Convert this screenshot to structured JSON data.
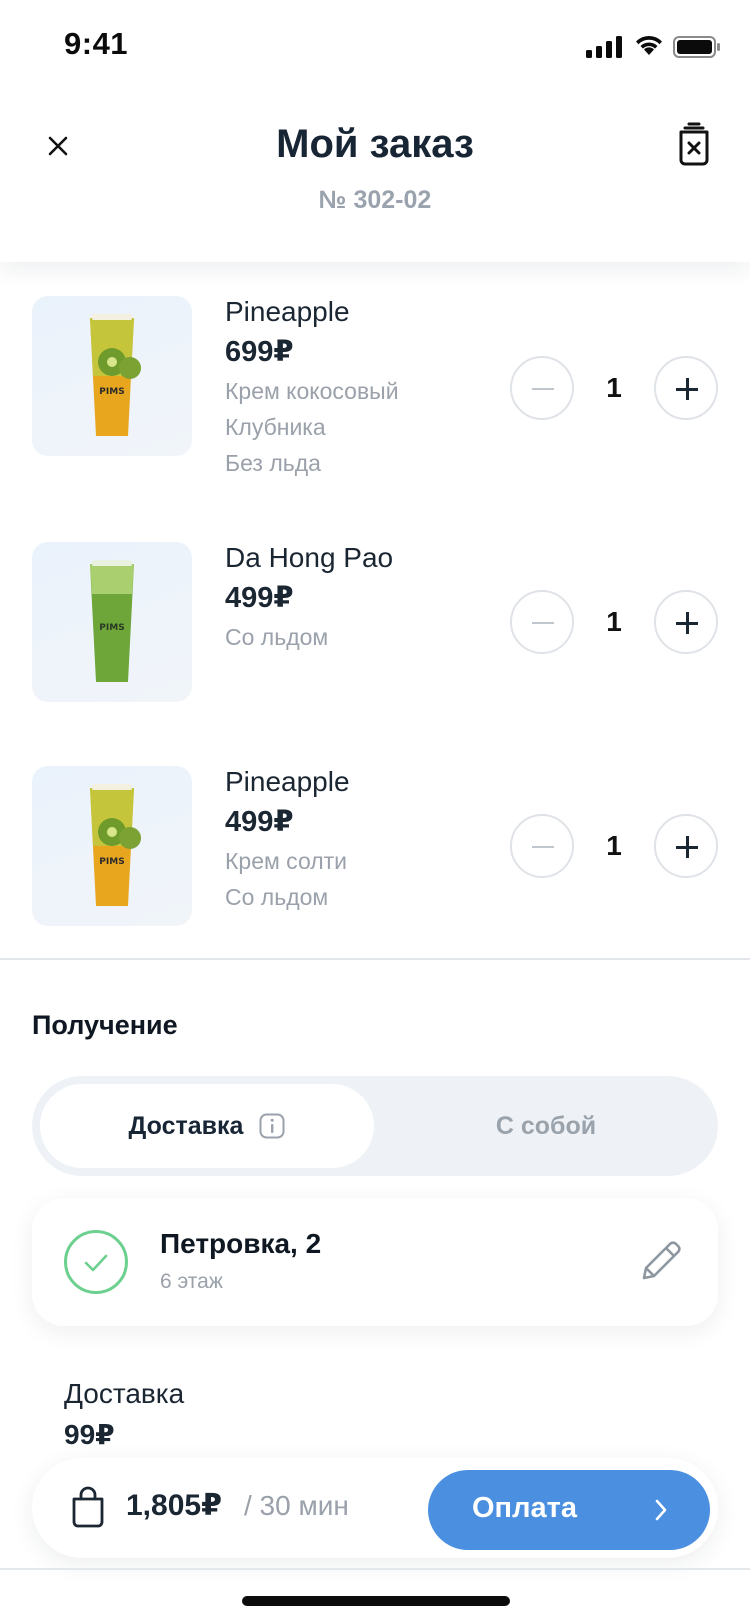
{
  "status_bar": {
    "time": "9:41"
  },
  "header": {
    "title": "Мой заказ",
    "order_number": "№ 302-02"
  },
  "items": [
    {
      "name": "Pineapple",
      "price": "699₽",
      "options": [
        "Крем кокосовый",
        "Клубника",
        "Без льда"
      ],
      "quantity": "1",
      "image": "pineapple-drink"
    },
    {
      "name": "Da Hong Pao",
      "price": "499₽",
      "options": [
        "Со льдом"
      ],
      "quantity": "1",
      "image": "green-tea-drink"
    },
    {
      "name": "Pineapple",
      "price": "499₽",
      "options": [
        "Крем солти",
        "Со льдом"
      ],
      "quantity": "1",
      "image": "pineapple-drink"
    }
  ],
  "receiving": {
    "title": "Получение",
    "tabs": [
      {
        "label": "Доставка",
        "active": true
      },
      {
        "label": "С собой",
        "active": false
      }
    ],
    "address": {
      "main": "Петровка, 2",
      "sub": "6 этаж"
    }
  },
  "delivery": {
    "label": "Доставка",
    "price": "99₽"
  },
  "footer": {
    "total": "1,805₽",
    "time_estimate": "/ 30 мин",
    "pay_label": "Оплата"
  },
  "colors": {
    "accent": "#4a8fe0",
    "success": "#6cd08f",
    "muted": "#9aa1aa",
    "text": "#172535"
  }
}
